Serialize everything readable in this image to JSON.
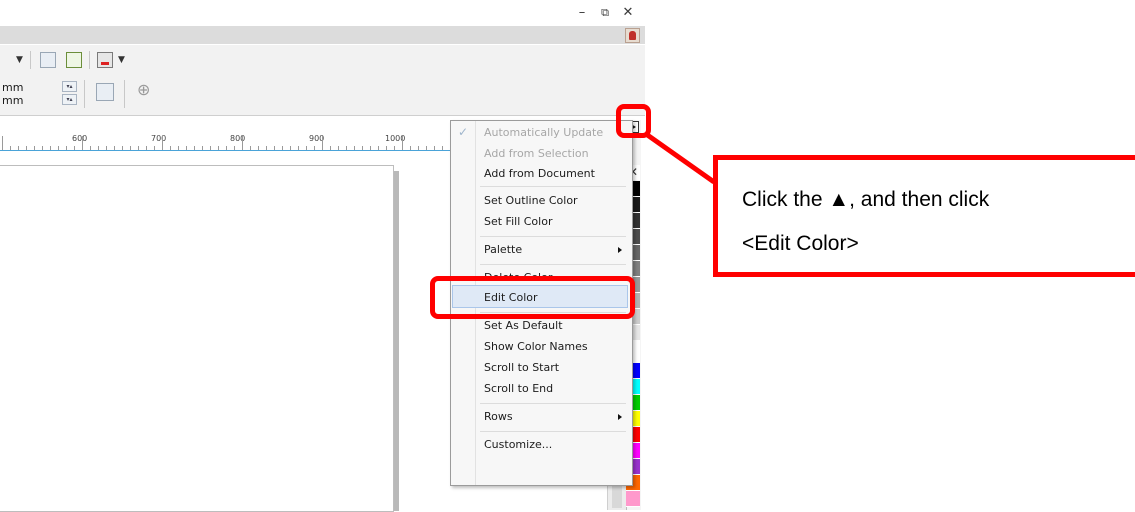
{
  "window": {
    "minimize_label": "–",
    "restore_label": "⧉",
    "close_label": "✕"
  },
  "toolbar": {
    "unit1": "mm",
    "unit2": "mm",
    "add_icon": "⊕"
  },
  "ruler": {
    "labels": [
      "600",
      "700",
      "800",
      "900",
      "1000"
    ]
  },
  "context_menu": {
    "checkmark": "✓",
    "items": [
      {
        "label": "Automatically Update",
        "disabled": true,
        "checked": true
      },
      {
        "label": "Add from Selection",
        "disabled": true
      },
      {
        "label": "Add from Document"
      },
      {
        "label": "Set Outline Color"
      },
      {
        "label": "Set Fill Color"
      },
      {
        "label": "Palette",
        "submenu": true
      },
      {
        "label": "Delete Color"
      },
      {
        "label": "Edit Color",
        "highlighted": true
      },
      {
        "label": "Set As Default"
      },
      {
        "label": "Show Color Names"
      },
      {
        "label": "Scroll to Start"
      },
      {
        "label": "Scroll to End"
      },
      {
        "label": "Rows",
        "submenu": true
      },
      {
        "label": "Customize..."
      }
    ]
  },
  "palette": {
    "swatches": [
      "#000000",
      "#1a1a1a",
      "#333333",
      "#4d4d4d",
      "#666666",
      "#808080",
      "#999999",
      "#b3b3b3",
      "#cccccc",
      "#e6e6e6",
      "#ffffff",
      "#ffffff",
      "#0000ff",
      "#00ffff",
      "#00cc00",
      "#ffff00",
      "#ff0000",
      "#ff00ff",
      "#9933cc",
      "#ff6600",
      "#ff99cc"
    ]
  },
  "annotation": {
    "line1": "Click the  ▲, and then click",
    "line2": "<Edit Color>",
    "color": "#ff0000"
  }
}
